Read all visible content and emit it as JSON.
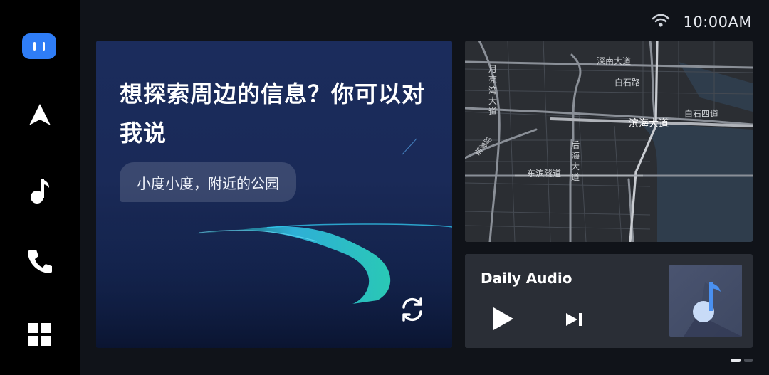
{
  "status_bar": {
    "time": "10:00AM",
    "wifi_icon": "wifi-icon"
  },
  "sidebar": {
    "items": [
      {
        "name": "voice-assistant",
        "icon": "assistant-face-icon"
      },
      {
        "name": "navigation",
        "icon": "navigation-arrow-icon"
      },
      {
        "name": "music",
        "icon": "music-note-icon"
      },
      {
        "name": "phone",
        "icon": "phone-icon"
      },
      {
        "name": "apps",
        "icon": "app-grid-icon"
      }
    ]
  },
  "voice_card": {
    "prompt": "想探索周边的信息？你可以对我说",
    "suggestion": "小度小度，附近的公园",
    "refresh_icon": "refresh-icon"
  },
  "map": {
    "labels": {
      "shennan": "深南大道",
      "baishi_road": "白石路",
      "baishi_4": "白石四道",
      "binhai": "滨海大道",
      "yueliangwan": "月亮湾大道",
      "houhai": "后海大道",
      "dongbin": "东滨隧道",
      "diagonal": "前海路"
    }
  },
  "audio": {
    "title": "Daily Audio",
    "play_icon": "play-icon",
    "next_icon": "skip-next-icon",
    "cover_icon": "music-note-icon"
  },
  "pager": {
    "pages": 2,
    "current": 1
  },
  "colors": {
    "accent": "#2f7df6",
    "teal_road": "#2ee6c8",
    "card_dark": "#2a2e36"
  }
}
